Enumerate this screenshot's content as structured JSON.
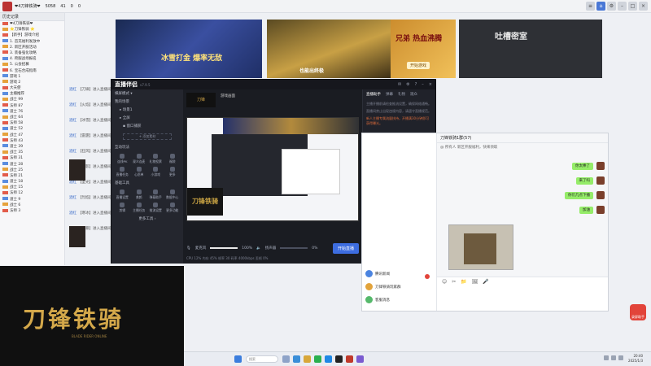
{
  "topbar": {
    "channel_title": "❤4刀锋铁骑❤",
    "counts": [
      "5058",
      "41",
      "0",
      "0"
    ],
    "window_buttons": [
      "菜单",
      "首页",
      "设置",
      "最小化",
      "最大化",
      "关闭"
    ]
  },
  "chat_panel": {
    "header": "历史记录",
    "pinned": "❤4刀锋铁骑❤",
    "rows": [
      "⭐刀锋铁骑 ⭐",
      "【新手】游戏介绍",
      "1. 首充福利发放中",
      "2. 新区开服活动",
      "3. 装备强化攻略",
      "4. 跨服战场报名",
      "5. 公会招募",
      "6. 宝石合成指南",
      "游戏 1",
      "游戏 2",
      "大天使",
      "主播推荐",
      "战士 99",
      "法师 87",
      "道士 76",
      "战士 64",
      "法师 58",
      "道士 52",
      "战士 47",
      "法师 43",
      "道士 39",
      "战士 35",
      "法师 31",
      "道士 28",
      "战士 25",
      "法师 21",
      "道士 18",
      "战士 15",
      "法师 12",
      "道士 9",
      "战士 6",
      "法师 3"
    ]
  },
  "banner": {
    "left_title": "冰雪打金 爆率无敌",
    "middle_caption": "也能出终极",
    "right_title": "兄弟 热血沸腾",
    "right_button": "开始游戏",
    "far_right_title": "吐槽密室"
  },
  "feed": {
    "rows": [
      {
        "user": "酒红",
        "text": "【刀锋】进入直播间"
      },
      {
        "user": "酒红",
        "text": "【火焰】进入直播间"
      },
      {
        "user": "酒红",
        "text": "【冰雪】进入直播间"
      },
      {
        "user": "酒红",
        "text": "【雷霆】进入直播间"
      },
      {
        "user": "酒红",
        "text": "【狂风】进入直播间"
      },
      {
        "user": "酒红",
        "text": "【暗影】进入直播间"
      },
      {
        "user": "酒红",
        "text": "【圣光】进入直播间"
      },
      {
        "user": "酒红",
        "text": "【烈焰】进入直播间"
      },
      {
        "user": "酒红",
        "text": "【寒冰】进入直播间"
      },
      {
        "user": "酒红",
        "text": "【风暴】进入直播间"
      }
    ]
  },
  "stream_app": {
    "logo": "直播伴侣",
    "version": "v7.9.5",
    "title_controls": [
      "消息",
      "设置",
      "帮助",
      "最小化",
      "关闭"
    ],
    "mode_label": "横屏模式",
    "scene_section": "我的场景",
    "scenes": [
      "场景1",
      "全屏"
    ],
    "source_item": "窗口捕获",
    "add_material": "+ 添加素材",
    "interact_section": "互动玩法",
    "interact_items": [
      "连线PK",
      "观众连麦",
      "礼物投票",
      "福袋",
      "直播任务",
      "心愿单",
      "小游戏",
      "更多"
    ],
    "tools_section": "基础工具",
    "tool_items": [
      "直播设置",
      "美颜",
      "弹幕助手",
      "数据中心",
      "剪辑",
      "主播任务",
      "推流设置",
      "更多功能"
    ],
    "more_tools": "更多工具",
    "preview_tab": "游戏画面",
    "preview_logo": "刀锋铁骑",
    "mic_label": "麦克风",
    "mic_volume": "100%",
    "speaker_label": "扬声器",
    "speaker_volume": "0%",
    "go_live": "开始直播",
    "status": "CPU 12%  内存 45%  帧率 30  码率 4000kbps  丢帧 0%",
    "right_tabs": [
      "直播助手",
      "弹幕",
      "礼物",
      "观众"
    ],
    "right_tip_1": "主播开播前请检查推流设置，确保网络通畅。",
    "right_tip_2": "直播间禁止出现违规内容，请遵守直播规范。",
    "right_tip_3": "新人主播专属流量扶持，开播满30分钟即可获得曝光。",
    "right_footer": "直播中遇到问题，可点击帮助中心反馈"
  },
  "chat_window": {
    "title": "刀锋铁骑1群(57)",
    "subtitle": "@ 所有人 新区开服福利，快来领取",
    "bubbles": [
      "你太棒了",
      "来了吗",
      "你们几点下播",
      "加油"
    ],
    "side_items": [
      "腾讯新闻",
      "刀锋铁骑玩家群",
      "客服消息"
    ],
    "input_tools": [
      "☺",
      "✂",
      "📁",
      "🖼",
      "🎤"
    ]
  },
  "game_logo": {
    "title": "刀锋铁骑",
    "subtitle": "BLADE RIDER ONLINE"
  },
  "taskbar": {
    "search_placeholder": "搜索",
    "time": "20:40",
    "date": "2025/1/3"
  },
  "float_button": "录屏助手"
}
